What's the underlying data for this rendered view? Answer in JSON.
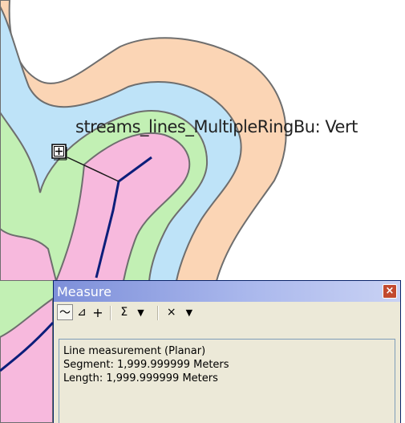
{
  "map": {
    "snap_tip": "streams_lines_MultipleRingBu: Vert",
    "colors": {
      "outer_ring": "#fbd5b5",
      "ring_2": "#bee3f8",
      "ring_3": "#c2f0b4",
      "inner_ring": "#f7b9dd",
      "outline": "#6e6e6e",
      "stream": "#0c1e7a",
      "measure_line": "#1a1a1a"
    },
    "snap_marker_icon": "snap-cursor-icon"
  },
  "measure": {
    "title": "Measure",
    "close_label": "×",
    "toolbar": {
      "measure_line_icon": "〜",
      "measure_area_icon": "⊿",
      "measure_feature_icon": "+",
      "sum_icon": "Σ",
      "sum_dropdown": "▼",
      "clear_icon": "×",
      "clear_dropdown": "▼"
    },
    "results": {
      "line1": "Line measurement (Planar)",
      "line2": "Segment: 1,999.999999 Meters",
      "line3": "Length: 1,999.999999 Meters"
    }
  }
}
